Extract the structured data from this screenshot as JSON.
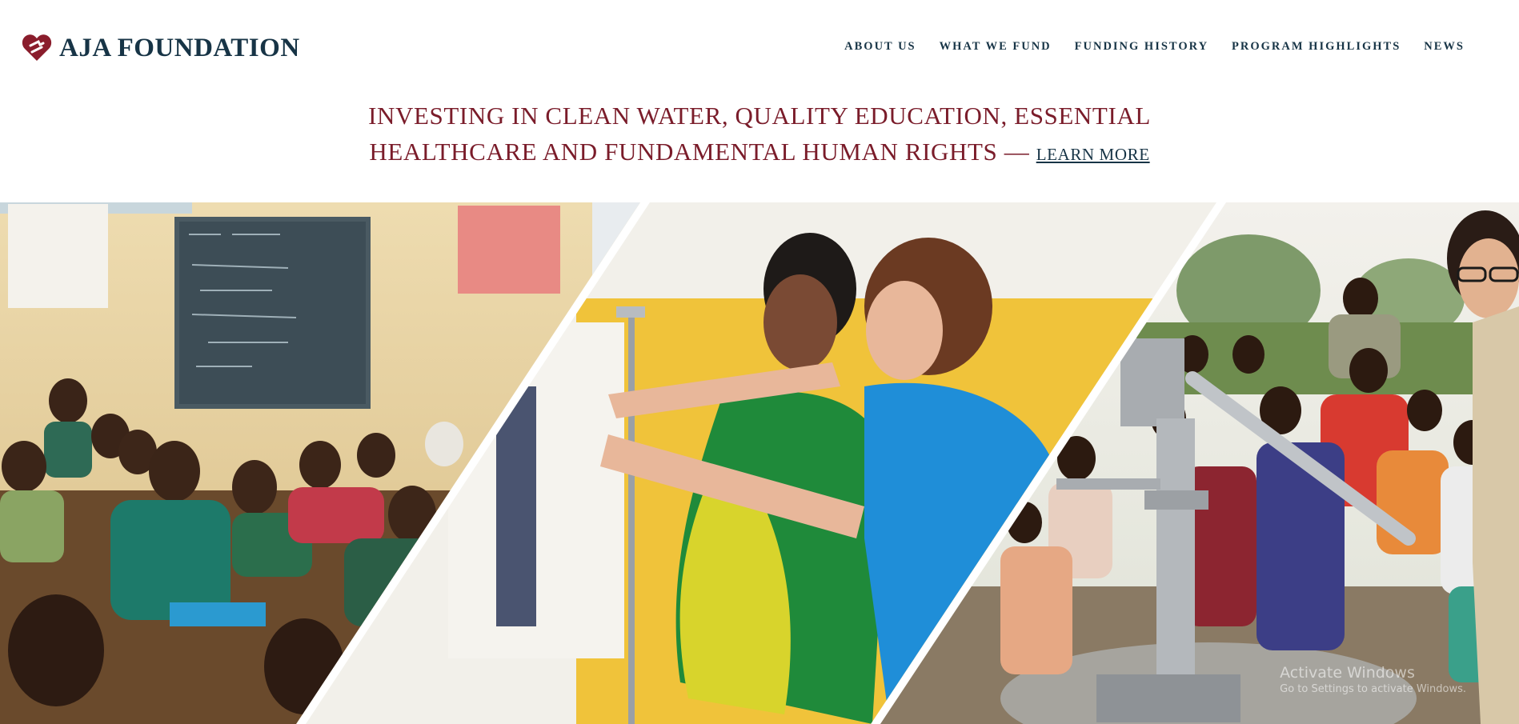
{
  "header": {
    "logo_text": "AJA FOUNDATION",
    "logo_icon": "heart-icon",
    "brand_color": "#7a1c2a",
    "nav_color": "#173446",
    "nav": [
      {
        "label": "ABOUT US"
      },
      {
        "label": "WHAT WE FUND"
      },
      {
        "label": "FUNDING HISTORY"
      },
      {
        "label": "PROGRAM HIGHLIGHTS"
      },
      {
        "label": "NEWS"
      }
    ]
  },
  "tagline": {
    "line1": "INVESTING IN CLEAN WATER, QUALITY EDUCATION, ESSENTIAL",
    "line2": "HEALTHCARE AND FUNDAMENTAL HUMAN RIGHTS —",
    "link": "LEARN MORE"
  },
  "hero": {
    "panels": [
      "classroom-photo",
      "healthcare-photo",
      "water-pump-photo"
    ]
  },
  "watermark": {
    "title": "Activate Windows",
    "subtitle": "Go to Settings to activate Windows."
  }
}
